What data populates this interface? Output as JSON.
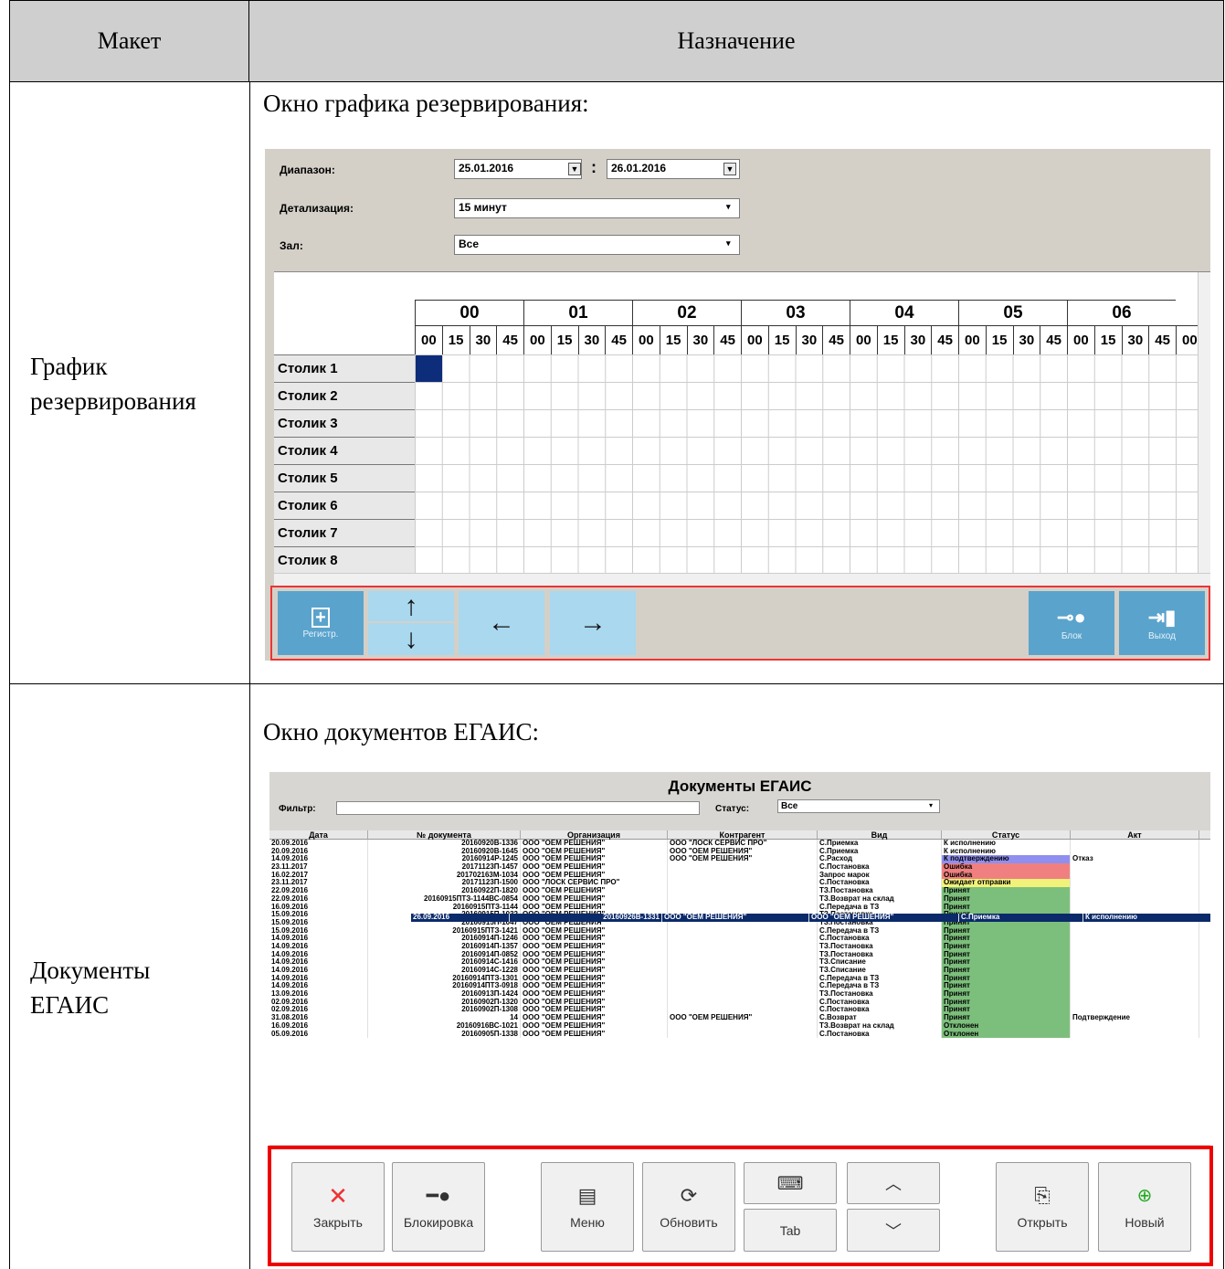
{
  "table": {
    "col1": "Макет",
    "col2": "Назначение"
  },
  "row1": {
    "label_lines": [
      "График",
      "резервирования"
    ],
    "intro": "Окно графика резервирования:",
    "window": {
      "fields": [
        {
          "label": "Диапазон:",
          "value1": "25.01.2016",
          "value2": "26.01.2016",
          "separator": ":"
        },
        {
          "label": "Детализация:",
          "value": "15 минут"
        },
        {
          "label": "Зал:",
          "value": "Все"
        }
      ],
      "hours": [
        "00",
        "01",
        "02",
        "03",
        "04",
        "05",
        "06"
      ],
      "minutes": [
        "00",
        "15",
        "30",
        "45",
        "00",
        "15",
        "30",
        "45",
        "00",
        "15",
        "30",
        "45",
        "00",
        "15",
        "30",
        "45",
        "00",
        "15",
        "30",
        "45",
        "00",
        "15",
        "30",
        "45",
        "00",
        "15",
        "30",
        "45",
        "00"
      ],
      "tables": [
        "Столик 1",
        "Столик 2",
        "Столик 3",
        "Столик 4",
        "Столик 5",
        "Столик 6",
        "Столик 7",
        "Столик 8"
      ],
      "buttons": {
        "register": "Регистр.",
        "block": "Блок",
        "exit": "Выход"
      }
    }
  },
  "row2": {
    "label_lines": [
      "Документы",
      "ЕГАИС"
    ],
    "intro": "Окно документов ЕГАИС:",
    "window": {
      "title": "Документы ЕГАИС",
      "filter_label": "Фильтр:",
      "filter_value": "",
      "status_label": "Статус:",
      "status_value": "Все",
      "columns": [
        "Дата",
        "№ документа",
        "Организация",
        "Контрагент",
        "Вид",
        "Статус",
        "Акт"
      ],
      "rows": [
        [
          "26.09.2016",
          "20160926B-1331",
          "ООО \"ОЕМ РЕШЕНИЯ\"",
          "ООО \"ОЕМ РЕШЕНИЯ\"",
          "С.Приемка",
          "К исполнению",
          ""
        ],
        [
          "20.09.2016",
          "20160920B-1336",
          "ООО \"ОЕМ РЕШЕНИЯ\"",
          "ООО \"ЛОСК СЕРВИС ПРО\"",
          "С.Приемка",
          "К исполнению",
          ""
        ],
        [
          "20.09.2016",
          "20160920B-1645",
          "ООО \"ОЕМ РЕШЕНИЯ\"",
          "ООО \"ОЕМ РЕШЕНИЯ\"",
          "С.Приемка",
          "К исполнению",
          ""
        ],
        [
          "14.09.2016",
          "20160914P-1245",
          "ООО \"ОЕМ РЕШЕНИЯ\"",
          "ООО \"ОЕМ РЕШЕНИЯ\"",
          "С.Расход",
          "К подтверждению",
          "Отказ"
        ],
        [
          "23.11.2017",
          "20171123П-1457",
          "ООО \"ОЕМ РЕШЕНИЯ\"",
          "",
          "С.Постановка",
          "Ошибка",
          ""
        ],
        [
          "16.02.2017",
          "201702163М-1034",
          "ООО \"ОЕМ РЕШЕНИЯ\"",
          "",
          "Запрос марок",
          "Ошибка",
          ""
        ],
        [
          "23.11.2017",
          "20171123П-1500",
          "ООО \"ЛОСК СЕРВИС ПРО\"",
          "",
          "С.Постановка",
          "Ожидает отправки",
          ""
        ],
        [
          "22.09.2016",
          "20160922П-1820",
          "ООО \"ОЕМ РЕШЕНИЯ\"",
          "",
          "ТЗ.Постановка",
          "Принят",
          ""
        ],
        [
          "22.09.2016",
          "20160915ПТЗ-1144ВС-0854",
          "ООО \"ОЕМ РЕШЕНИЯ\"",
          "",
          "ТЗ.Возврат на склад",
          "Принят",
          ""
        ],
        [
          "16.09.2016",
          "20160915ПТЗ-1144",
          "ООО \"ОЕМ РЕШЕНИЯ\"",
          "",
          "С.Передача в ТЗ",
          "Принят",
          ""
        ],
        [
          "15.09.2016",
          "20160915П-1032",
          "ООО \"ОЕМ РЕШЕНИЯ\"",
          "",
          "ТЗ.Постановка",
          "Принят",
          ""
        ],
        [
          "15.09.2016",
          "20160915П-1047",
          "ООО \"ОЕМ РЕШЕНИЯ\"",
          "",
          "ТЗ.Постановка",
          "Принят",
          ""
        ],
        [
          "15.09.2016",
          "20160915ПТЗ-1421",
          "ООО \"ОЕМ РЕШЕНИЯ\"",
          "",
          "С.Передача в ТЗ",
          "Принят",
          ""
        ],
        [
          "14.09.2016",
          "20160914П-1246",
          "ООО \"ОЕМ РЕШЕНИЯ\"",
          "",
          "С.Постановка",
          "Принят",
          ""
        ],
        [
          "14.09.2016",
          "20160914П-1357",
          "ООО \"ОЕМ РЕШЕНИЯ\"",
          "",
          "ТЗ.Постановка",
          "Принят",
          ""
        ],
        [
          "14.09.2016",
          "20160914П-0852",
          "ООО \"ОЕМ РЕШЕНИЯ\"",
          "",
          "ТЗ.Постановка",
          "Принят",
          ""
        ],
        [
          "14.09.2016",
          "20160914С-1416",
          "ООО \"ОЕМ РЕШЕНИЯ\"",
          "",
          "ТЗ.Списание",
          "Принят",
          ""
        ],
        [
          "14.09.2016",
          "20160914С-1228",
          "ООО \"ОЕМ РЕШЕНИЯ\"",
          "",
          "ТЗ.Списание",
          "Принят",
          ""
        ],
        [
          "14.09.2016",
          "20160914ПТЗ-1301",
          "ООО \"ОЕМ РЕШЕНИЯ\"",
          "",
          "С.Передача в ТЗ",
          "Принят",
          ""
        ],
        [
          "14.09.2016",
          "20160914ПТЗ-0918",
          "ООО \"ОЕМ РЕШЕНИЯ\"",
          "",
          "С.Передача в ТЗ",
          "Принят",
          ""
        ],
        [
          "13.09.2016",
          "20160913П-1424",
          "ООО \"ОЕМ РЕШЕНИЯ\"",
          "",
          "ТЗ.Постановка",
          "Принят",
          ""
        ],
        [
          "02.09.2016",
          "20160902П-1320",
          "ООО \"ОЕМ РЕШЕНИЯ\"",
          "",
          "С.Постановка",
          "Принят",
          ""
        ],
        [
          "02.09.2016",
          "20160902П-1308",
          "ООО \"ОЕМ РЕШЕНИЯ\"",
          "",
          "С.Постановка",
          "Принят",
          ""
        ],
        [
          "31.08.2016",
          "14",
          "ООО \"ОЕМ РЕШЕНИЯ\"",
          "ООО \"ОЕМ РЕШЕНИЯ\"",
          "С.Возврат",
          "Принят",
          "Подтверждение"
        ],
        [
          "16.09.2016",
          "20160916ВС-1021",
          "ООО \"ОЕМ РЕШЕНИЯ\"",
          "",
          "ТЗ.Возврат на склад",
          "Отклонен",
          ""
        ],
        [
          "05.09.2016",
          "20160905П-1338",
          "ООО \"ОЕМ РЕШЕНИЯ\"",
          "",
          "С.Постановка",
          "Отклонен",
          ""
        ]
      ],
      "status_colors": {
        "К исполнению": "#ffffff",
        "К подтверждению": "#8f8ff0",
        "Ошибка": "#f08080",
        "Ожидает отправки": "#f2f27a",
        "Принят": "#7cbf7c",
        "Отклонен": "#7cbf7c"
      },
      "buttons": {
        "close": "Закрыть",
        "lock": "Блокировка",
        "menu": "Меню",
        "refresh": "Обновить",
        "tab": "Tab",
        "open": "Открыть",
        "new": "Новый"
      }
    }
  }
}
